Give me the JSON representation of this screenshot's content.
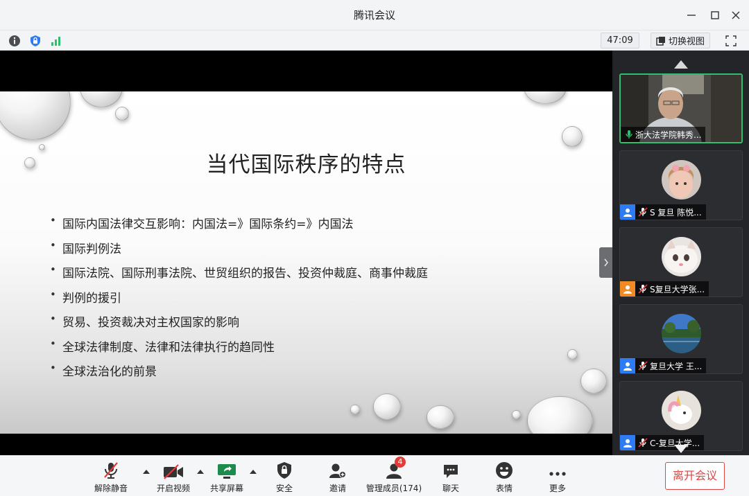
{
  "window": {
    "title": "腾讯会议"
  },
  "statusbar": {
    "timer": "47:09",
    "switch_view": "切换视图"
  },
  "slide": {
    "title": "当代国际秩序的特点",
    "bullets": [
      "国际内国法律交互影响：内国法=》国际条约=》内国法",
      "国际判例法",
      "国际法院、国际刑事法院、世贸组织的报告、投资仲裁庭、商事仲裁庭",
      "判例的援引",
      "贸易、投资裁决对主权国家的影响",
      "全球法律制度、法律和法律执行的趋同性",
      "全球法治化的前景"
    ]
  },
  "participants": [
    {
      "name": "浙大法学院韩秀...",
      "role_color": "",
      "mic": "on",
      "type": "video"
    },
    {
      "name": "S 复旦 陈悦...",
      "role_color": "#2d7cf6",
      "mic": "muted",
      "type": "avatar-child"
    },
    {
      "name": "S复旦大学张...",
      "role_color": "#f08a24",
      "mic": "muted",
      "type": "avatar-cat"
    },
    {
      "name": "复旦大学 王...",
      "role_color": "#2d7cf6",
      "mic": "muted",
      "type": "avatar-lake"
    },
    {
      "name": "C-复旦大学...",
      "role_color": "#2d7cf6",
      "mic": "muted",
      "type": "avatar-unicorn"
    }
  ],
  "toolbar": {
    "unmute": "解除静音",
    "video": "开启视频",
    "share": "共享屏幕",
    "security": "安全",
    "invite": "邀请",
    "members": "管理成员(174)",
    "members_badge": "4",
    "chat": "聊天",
    "reactions": "表情",
    "more": "更多",
    "leave": "离开会议"
  },
  "colors": {
    "leave": "#e04444",
    "active_border": "#2fbf71",
    "role_blue": "#2d7cf6",
    "role_orange": "#f08a24"
  }
}
